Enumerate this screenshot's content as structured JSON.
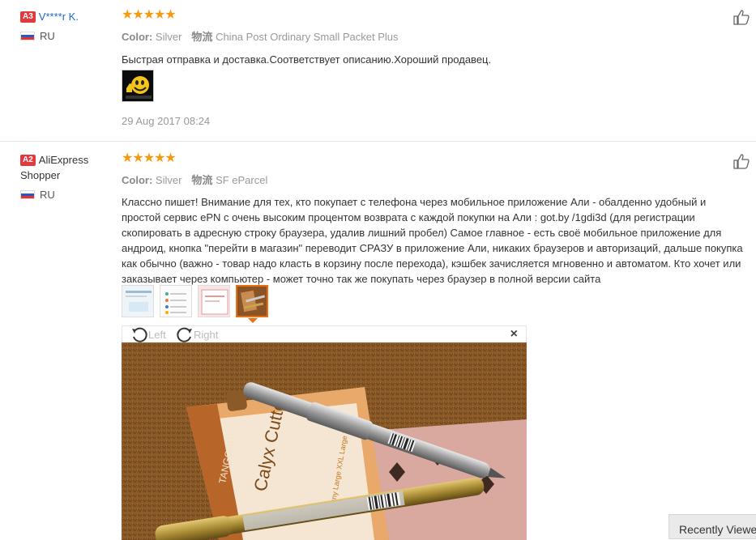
{
  "reviews": [
    {
      "level": "A3",
      "user": "V****r K.",
      "country": "RU",
      "stars": "★★★★★",
      "color_label": "Color:",
      "color_value": "Silver",
      "shipping_label": "物流",
      "shipping_value": "China Post Ordinary Small Packet Plus",
      "text": "Быстрая отправка и доставка.Соответствует описанию.Хороший продавец.",
      "date": "29 Aug 2017 08:24"
    },
    {
      "level": "A2",
      "user": "AliExpress Shopper",
      "country": "RU",
      "stars": "★★★★★",
      "color_label": "Color:",
      "color_value": "Silver",
      "shipping_label": "物流",
      "shipping_value": "SF eParcel",
      "text": "Классно пишет! Внимание для тех, кто покупает с телефона через мобильное приложение Али - обалденно удобный и простой сервис ePN с очень высоким процентом возврата с каждой покупки на Али : got.by /1gdi3d (для регистрации скопировать в адресную строку браузера, удалив лишний пробел) Самое главное - есть своё мобильное приложение для андроид, кнопка \"перейти в магазин\" переводит СРАЗУ в приложение Али, никаких браузеров и авторизаций, дальше покупка как обычно (важно - товар надо класть в корзину после перехода), кэшбек зачисляется мгновенно и автоматом. Кто хочет или заказывает через компьютер - может точно так же покупать через браузер в полной версии сайта"
    }
  ],
  "viewer": {
    "left_label": "Left",
    "right_label": "Right",
    "close": "×",
    "card_brand": "TANGCHU",
    "card_title": "Calyx Cutter",
    "card_small": "Sunny Large XXL Large XXL"
  },
  "recent": "Recently Viewed"
}
